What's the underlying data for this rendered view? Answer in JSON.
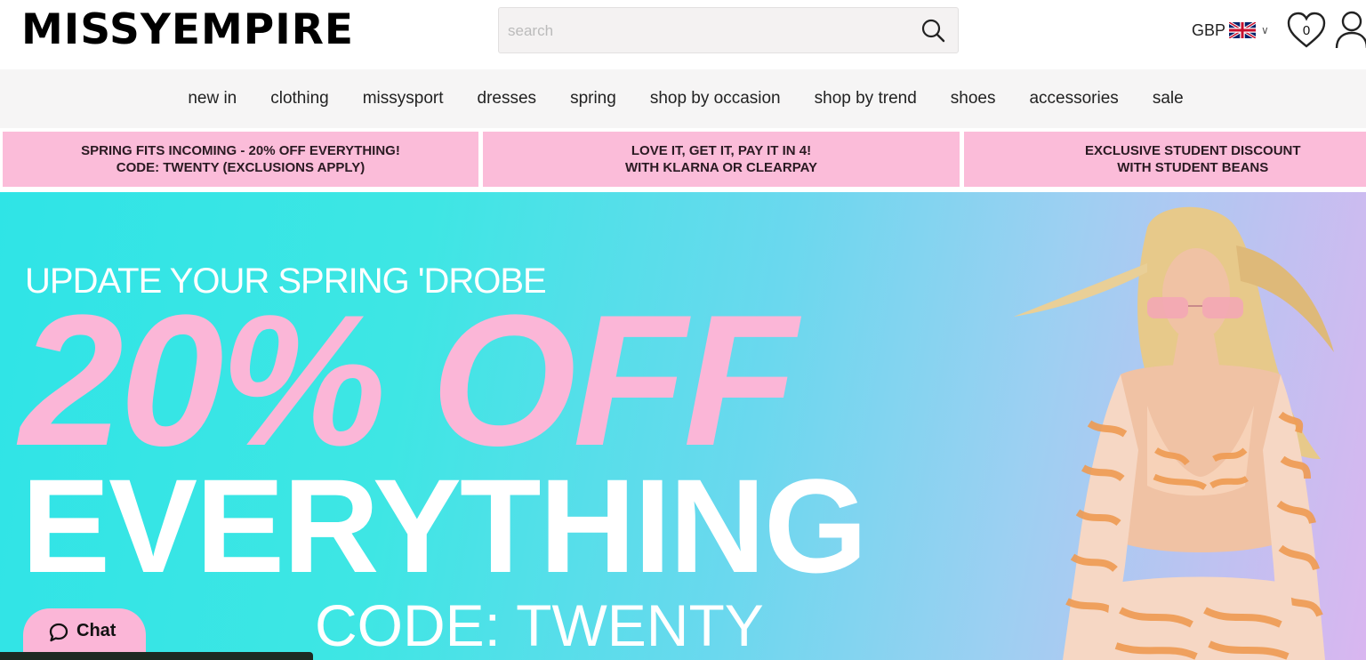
{
  "header": {
    "logo": "MISSYEMPIRE",
    "search_placeholder": "search",
    "currency": "GBP",
    "wishlist_count": "0"
  },
  "nav": {
    "items": [
      "new in",
      "clothing",
      "missysport",
      "dresses",
      "spring",
      "shop by occasion",
      "shop by trend",
      "shoes",
      "accessories",
      "sale"
    ]
  },
  "promos": [
    {
      "line1": "SPRING FITS INCOMING - 20% OFF EVERYTHING!",
      "line2": "CODE: TWENTY (EXCLUSIONS APPLY)"
    },
    {
      "line1": "LOVE IT, GET IT, PAY IT IN 4!",
      "line2": "WITH KLARNA OR CLEARPAY"
    },
    {
      "line1": "EXCLUSIVE STUDENT DISCOUNT",
      "line2": "WITH STUDENT BEANS"
    }
  ],
  "hero": {
    "subtitle": "UPDATE YOUR SPRING 'DROBE",
    "headline": "20% OFF",
    "headline2": "EVERYTHING",
    "code": "CODE: TWENTY"
  },
  "chat": {
    "label": "Chat"
  },
  "colors": {
    "promo_bg": "#fbbcd9",
    "hero_pink": "#fbb6d7",
    "hero_cyan": "#2fe4e6"
  },
  "icons": [
    "search-icon",
    "uk-flag-icon",
    "chevron-down-icon",
    "heart-icon",
    "user-icon",
    "chat-bubble-icon"
  ]
}
